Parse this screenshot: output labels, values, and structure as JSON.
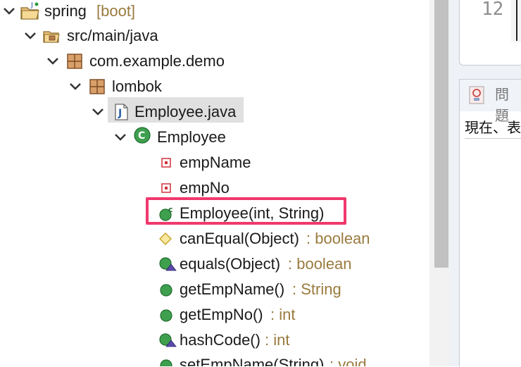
{
  "tree": {
    "project": {
      "name": "spring",
      "meta": "[boot]"
    },
    "src": "src/main/java",
    "pkg1": "com.example.demo",
    "pkg2": "lombok",
    "file": "Employee.java",
    "cls": "Employee",
    "members": [
      {
        "name": "empName",
        "meta": "",
        "icon": "private-field-icon"
      },
      {
        "name": "empNo",
        "meta": "",
        "icon": "private-field-icon"
      },
      {
        "name": "Employee(int, String)",
        "meta": "",
        "icon": "constructor-icon"
      },
      {
        "name": "canEqual(Object)",
        "meta": " : boolean",
        "icon": "protected-method-icon"
      },
      {
        "name": "equals(Object)",
        "meta": " : boolean",
        "icon": "override-method-icon"
      },
      {
        "name": "getEmpName()",
        "meta": " : String",
        "icon": "public-method-icon"
      },
      {
        "name": "getEmpNo()",
        "meta": " : int",
        "icon": "public-method-icon"
      },
      {
        "name": "hashCode()",
        "meta": " : int",
        "icon": "override-method-icon"
      },
      {
        "name": "setEmpName(String)",
        "meta": " : void",
        "icon": "public-method-icon"
      }
    ]
  },
  "editor": {
    "line_number": "12"
  },
  "problems": {
    "title": "問題",
    "message": "現在、表"
  },
  "colors": {
    "highlight": "#f0396e",
    "meta": "#9a7b3f",
    "method": "#2e9a3e",
    "field": "#d0313d"
  }
}
